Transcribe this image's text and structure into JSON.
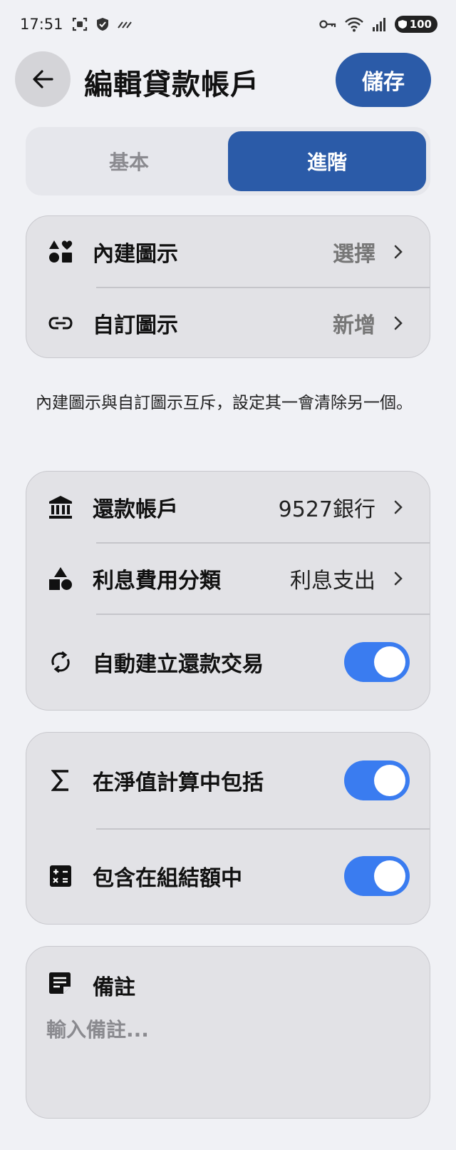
{
  "status_bar": {
    "time": "17:51",
    "battery": "100",
    "icons": [
      "screenshot-icon",
      "shield-icon",
      "data-saver-icon",
      "key-icon",
      "wifi-icon",
      "signal-icon"
    ]
  },
  "header": {
    "title": "編輯貸款帳戶",
    "save_label": "儲存"
  },
  "tabs": [
    {
      "label": "基本",
      "active": false
    },
    {
      "label": "進階",
      "active": true
    }
  ],
  "icon_section": {
    "builtin": {
      "label": "內建圖示",
      "value": "選擇",
      "icon": "shapes-icon"
    },
    "custom": {
      "label": "自訂圖示",
      "value": "新增",
      "icon": "link-icon"
    }
  },
  "hint": "內建圖示與自訂圖示互斥，設定其一會清除另一個。",
  "repayment_section": {
    "account": {
      "label": "還款帳戶",
      "value": "9527銀行",
      "icon": "bank-icon"
    },
    "interest_category": {
      "label": "利息費用分類",
      "value": "利息支出",
      "icon": "category-icon"
    },
    "auto_create": {
      "label": "自動建立還款交易",
      "checked": true,
      "icon": "sync-icon"
    }
  },
  "totals_section": {
    "net_worth": {
      "label": "在淨值計算中包括",
      "checked": true,
      "icon": "sigma-icon"
    },
    "group_total": {
      "label": "包含在組結額中",
      "checked": true,
      "icon": "calculator-icon"
    }
  },
  "notes": {
    "title": "備註",
    "placeholder": "輸入備註...",
    "value": "",
    "icon": "note-icon"
  },
  "colors": {
    "primary": "#2b5ba8",
    "toggle_on": "#3a7cf0",
    "background": "#f0f1f5",
    "card": "#e2e2e6"
  }
}
